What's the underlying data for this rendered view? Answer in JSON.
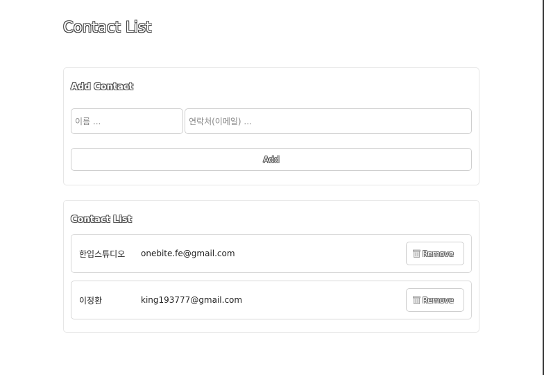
{
  "app": {
    "title": "Contact List"
  },
  "add_contact": {
    "heading": "Add Contact",
    "name_placeholder": "이름 ...",
    "name_value": "",
    "email_placeholder": "연락처(이메일) ...",
    "email_value": "",
    "add_label": "Add"
  },
  "contact_list": {
    "heading": "Contact List",
    "remove_label": "Remove",
    "remove_icon": "trash-icon",
    "items": [
      {
        "name": "한입스튜디오",
        "email": "onebite.fe@gmail.com"
      },
      {
        "name": "이정환",
        "email": "king193777@gmail.com"
      }
    ]
  }
}
